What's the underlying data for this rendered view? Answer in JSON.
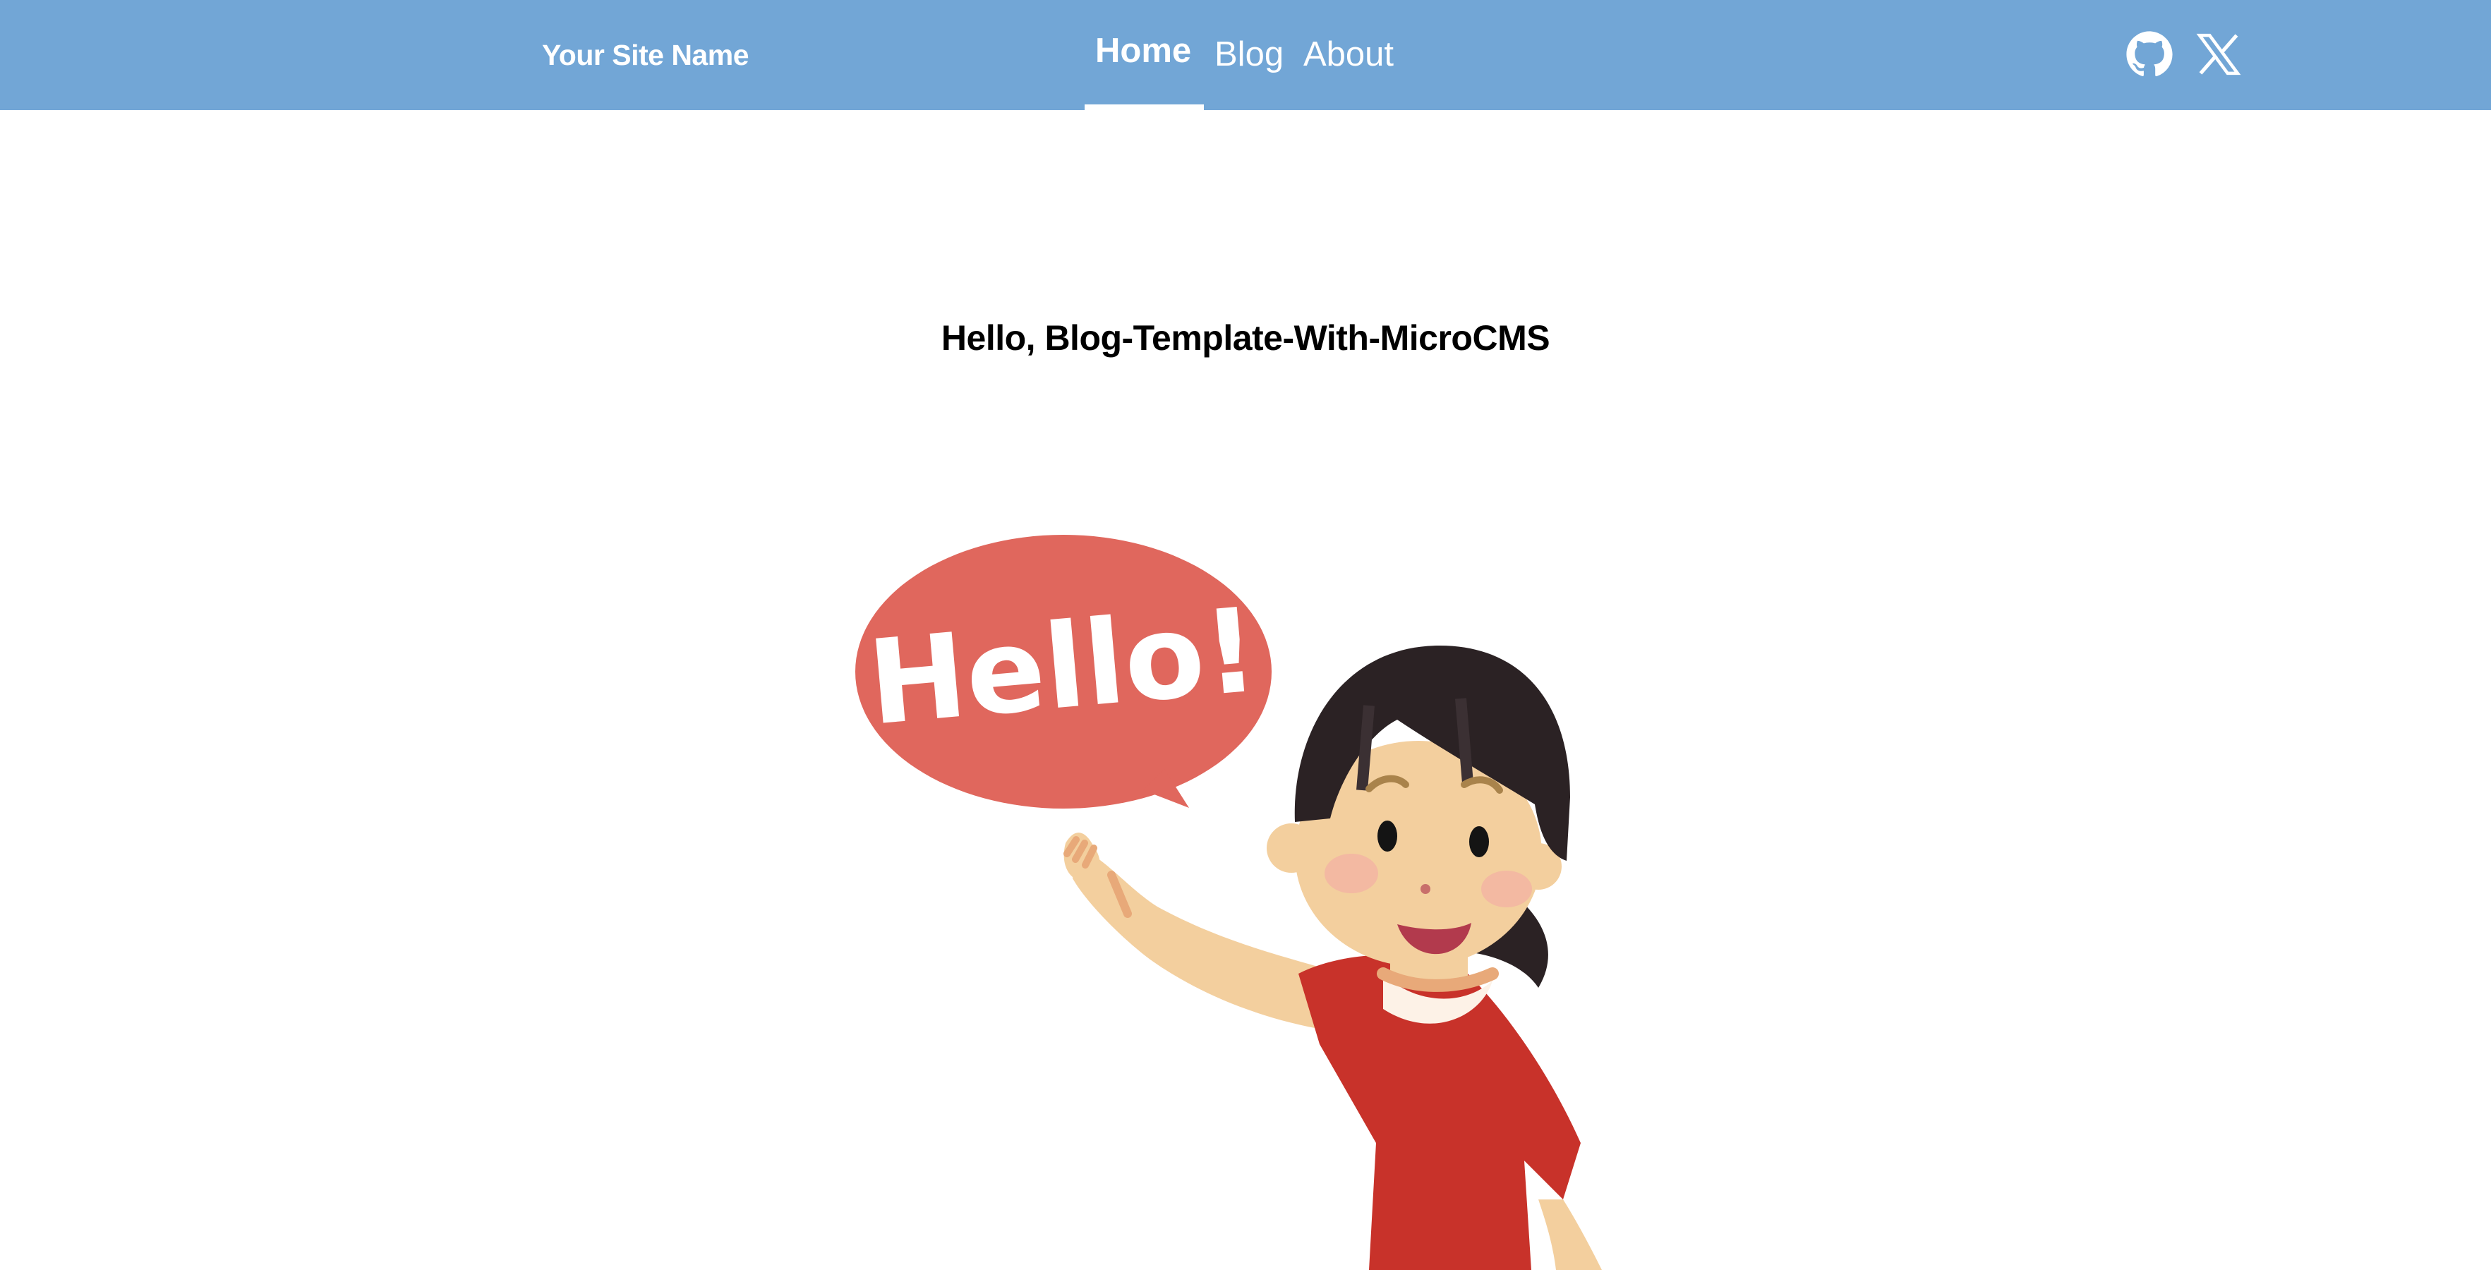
{
  "header": {
    "site_name": "Your Site Name",
    "nav": [
      {
        "label": "Home",
        "active": true
      },
      {
        "label": "Blog",
        "active": false
      },
      {
        "label": "About",
        "active": false
      }
    ],
    "icons": [
      "github-icon",
      "x-icon"
    ],
    "background_color": "#72a6d6"
  },
  "main": {
    "title": "Hello, Blog-Template-With-MicroCMS",
    "hero_image": {
      "bubble_text": "Hello!",
      "bubble_color": "#e0675d"
    }
  }
}
